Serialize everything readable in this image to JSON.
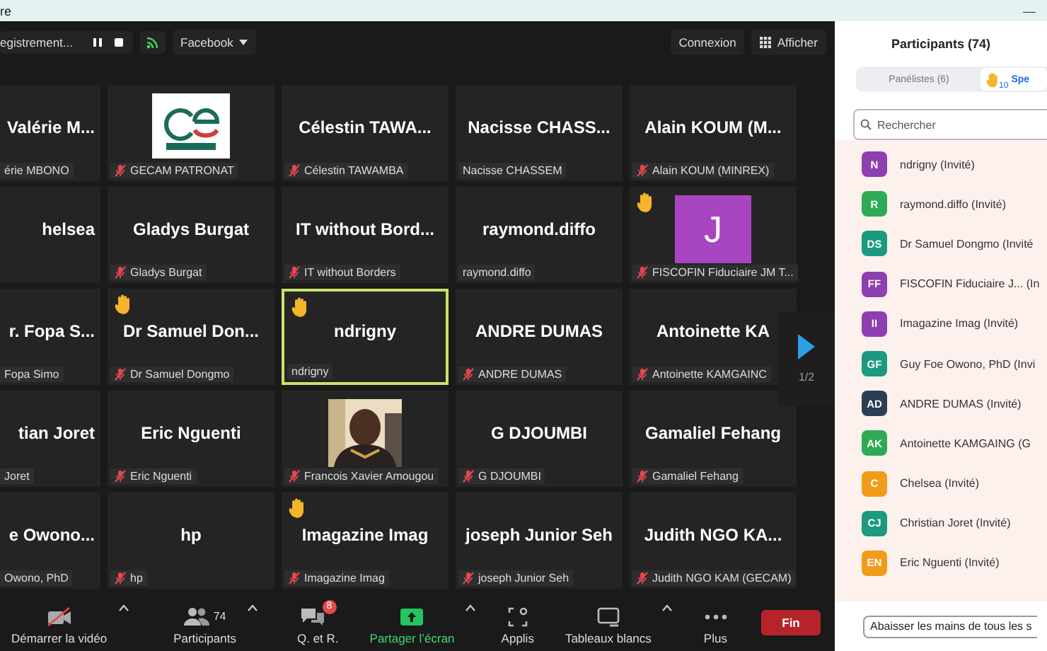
{
  "window": {
    "title": "re",
    "minimize": "—"
  },
  "top_bar": {
    "recording": "egistrement...",
    "stream_target": "Facebook",
    "right_buttons": [
      {
        "label": "Connexion",
        "kind": "plain"
      },
      {
        "label": "Afficher",
        "kind": "grid"
      }
    ]
  },
  "tiles": [
    {
      "name": "Valérie M...",
      "label": "érie MBONO",
      "muted": false,
      "hand": false,
      "speaking": false
    },
    {
      "label": "GECAM PATRONAT",
      "muted": true,
      "hand": false,
      "speaking": false
    },
    {
      "name": "Célestin  TAWA...",
      "label": "Célestin TAWAMBA",
      "muted": true,
      "hand": false,
      "speaking": false
    },
    {
      "name": "Nacisse  CHASS...",
      "label": "Nacisse CHASSEM",
      "muted": false,
      "hand": false,
      "speaking": false
    },
    {
      "name": "Alain  KOUM  (M...",
      "label": "Alain KOUM (MINREX)",
      "muted": true,
      "hand": false,
      "speaking": false
    },
    {
      "name": "helsea",
      "muted": false,
      "hand": false,
      "speaking": false
    },
    {
      "name": "Gladys Burgat",
      "label": "Gladys Burgat",
      "muted": true,
      "hand": false,
      "speaking": false
    },
    {
      "name": "IT  without  Bord...",
      "label": "IT without Borders",
      "muted": true,
      "hand": false,
      "speaking": false
    },
    {
      "name": "raymond.diffo",
      "label": "raymond.diffo",
      "muted": false,
      "hand": false,
      "speaking": false
    },
    {
      "label": "FISCOFIN Fiduciaire JM T...",
      "muted": true,
      "hand": true,
      "speaking": false,
      "avatar": {
        "kind": "letter",
        "text": "J",
        "color": "#a846c2"
      }
    },
    {
      "name": "r.  Fopa S...",
      "label": "Fopa Simo",
      "muted": false,
      "hand": false,
      "speaking": false
    },
    {
      "name": "Dr  Samuel  Don...",
      "label": "Dr Samuel Dongmo",
      "muted": true,
      "hand": true,
      "speaking": false
    },
    {
      "name": "ndrigny",
      "label": "ndrigny",
      "muted": false,
      "hand": true,
      "speaking": true
    },
    {
      "name": "ANDRE DUMAS",
      "label": "ANDRE DUMAS",
      "muted": true,
      "hand": false,
      "speaking": false
    },
    {
      "name": "Antoinette  KA",
      "label": "Antoinette KAMGAINC",
      "muted": true,
      "hand": false,
      "speaking": false
    },
    {
      "name": "tian Joret",
      "label": "Joret",
      "muted": false,
      "hand": false,
      "speaking": false
    },
    {
      "name": "Eric Nguenti",
      "label": "Eric Nguenti",
      "muted": true,
      "hand": false,
      "speaking": false
    },
    {
      "label": "Francois Xavier Amougou",
      "muted": true,
      "hand": false,
      "speaking": false
    },
    {
      "name": "G DJOUMBI",
      "label": "G DJOUMBI",
      "muted": true,
      "hand": false,
      "speaking": false
    },
    {
      "name": "Gamaliel Fehang",
      "label": "Gamaliel Fehang",
      "muted": true,
      "hand": false,
      "speaking": false
    },
    {
      "name": "e  Owono...",
      "label": "Owono, PhD",
      "muted": false,
      "hand": false,
      "speaking": false
    },
    {
      "name": "hp",
      "label": "hp",
      "muted": true,
      "hand": false,
      "speaking": false
    },
    {
      "name": "Imagazine Imag",
      "label": "Imagazine Imag",
      "muted": true,
      "hand": true,
      "speaking": false
    },
    {
      "name": "joseph Junior Seh",
      "label": "joseph Junior Seh",
      "muted": true,
      "hand": false,
      "speaking": false
    },
    {
      "name": "Judith  NGO  KA...",
      "label": "Judith NGO KAM (GECAM)",
      "muted": true,
      "hand": false,
      "speaking": false
    }
  ],
  "pager": "1/2",
  "toolbar": [
    {
      "kind": "video",
      "label": "Démarrer la vidéo",
      "caret": true
    },
    {
      "kind": "participants",
      "label": "Participants",
      "count": "74",
      "caret": true
    },
    {
      "kind": "qa",
      "label": "Q. et R.",
      "badge": "8"
    },
    {
      "kind": "share",
      "label": "Partager l’écran",
      "caret": true
    },
    {
      "kind": "apps",
      "label": "Applis"
    },
    {
      "kind": "whiteboard",
      "label": "Tableaux blancs",
      "caret": true
    },
    {
      "kind": "more",
      "label": "Plus"
    },
    {
      "kind": "end",
      "label": "Fin"
    }
  ],
  "panel": {
    "title": "Participants (74)",
    "tabs": [
      {
        "label": "Panélistes (6)",
        "selected": false
      },
      {
        "label": "Spe",
        "count": "10",
        "selected": true
      }
    ],
    "search": {
      "placeholder": "Rechercher"
    },
    "people": [
      {
        "initials": "N",
        "name": "ndrigny (Invité)",
        "color": "#8e3fb0"
      },
      {
        "initials": "R",
        "name": "raymond.diffo (Invité)",
        "color": "#2eaa55"
      },
      {
        "initials": "DS",
        "name": "Dr Samuel Dongmo (Invité",
        "color": "#1a9a7e"
      },
      {
        "initials": "FF",
        "name": "FISCOFIN Fiduciaire J...  (In",
        "color": "#8e3fb0"
      },
      {
        "initials": "II",
        "name": "Imagazine Imag (Invité)",
        "color": "#8e3fb0"
      },
      {
        "initials": "GF",
        "name": "Guy Foe Owono, PhD (Invi",
        "color": "#1a9a7e"
      },
      {
        "initials": "AD",
        "name": "ANDRE DUMAS (Invité)",
        "color": "#2c3e55"
      },
      {
        "initials": "AK",
        "name": "Antoinette KAMGAING (G",
        "color": "#2eaa55"
      },
      {
        "initials": "C",
        "name": "Chelsea (Invité)",
        "color": "#f29b1a"
      },
      {
        "initials": "CJ",
        "name": "Christian Joret (Invité)",
        "color": "#1a9a7e"
      },
      {
        "initials": "EN",
        "name": "Eric Nguenti (Invité)",
        "color": "#f29b1a"
      }
    ],
    "footer_button": "Abaisser les mains de tous les s"
  }
}
